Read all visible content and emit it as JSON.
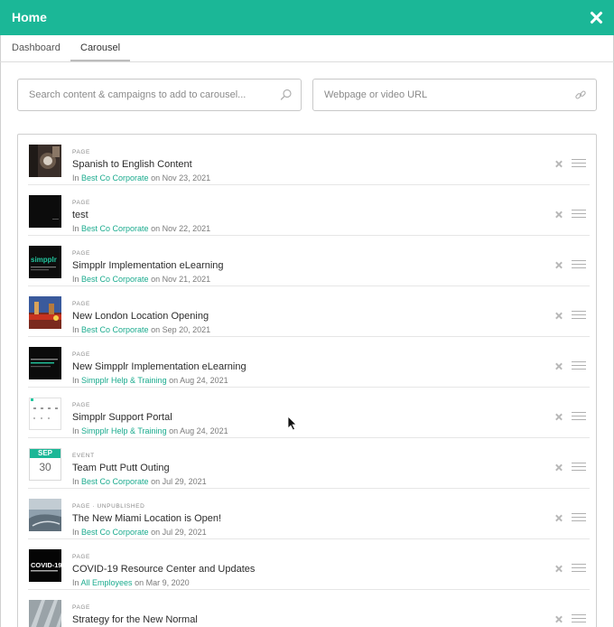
{
  "header": {
    "title": "Home"
  },
  "tabs": [
    {
      "label": "Dashboard"
    },
    {
      "label": "Carousel"
    }
  ],
  "search": {
    "placeholder": "Search content & campaigns to add to carousel..."
  },
  "url": {
    "placeholder": "Webpage or video URL"
  },
  "accent_color": "#1bb797",
  "items": [
    {
      "type": "PAGE",
      "title": "Spanish to English Content",
      "prefix": "In",
      "site": "Best Co Corporate",
      "date": "on Nov 23, 2021"
    },
    {
      "type": "PAGE",
      "title": "test",
      "prefix": "In",
      "site": "Best Co Corporate",
      "date": "on Nov 22, 2021"
    },
    {
      "type": "PAGE",
      "title": "Simpplr Implementation eLearning",
      "prefix": "In",
      "site": "Best Co Corporate",
      "date": "on Nov 21, 2021"
    },
    {
      "type": "PAGE",
      "title": "New London Location Opening",
      "prefix": "In",
      "site": "Best Co Corporate",
      "date": "on Sep 20, 2021"
    },
    {
      "type": "PAGE",
      "title": "New Simpplr Implementation eLearning",
      "prefix": "In",
      "site": "Simpplr Help & Training",
      "date": "on Aug 24, 2021"
    },
    {
      "type": "PAGE",
      "title": "Simpplr Support Portal",
      "prefix": "In",
      "site": "Simpplr Help & Training",
      "date": "on Aug 24, 2021"
    },
    {
      "type": "EVENT",
      "title": "Team Putt Putt Outing",
      "prefix": "In",
      "site": "Best Co Corporate",
      "date": "on Jul 29, 2021",
      "calendar": {
        "month": "SEP",
        "day": "30"
      }
    },
    {
      "type": "PAGE · UNPUBLISHED",
      "title": "The New Miami Location is Open!",
      "prefix": "In",
      "site": "Best Co Corporate",
      "date": "on Jul 29, 2021"
    },
    {
      "type": "PAGE",
      "title": "COVID-19 Resource Center and Updates",
      "prefix": "In",
      "site": "All Employees",
      "date": "on Mar 9, 2020"
    },
    {
      "type": "PAGE",
      "title": "Strategy for the New Normal",
      "prefix": "",
      "site": "",
      "date": ""
    }
  ],
  "thumb_captions": {
    "simpplr_logo": "simpplr",
    "covid": "COVID-19"
  }
}
